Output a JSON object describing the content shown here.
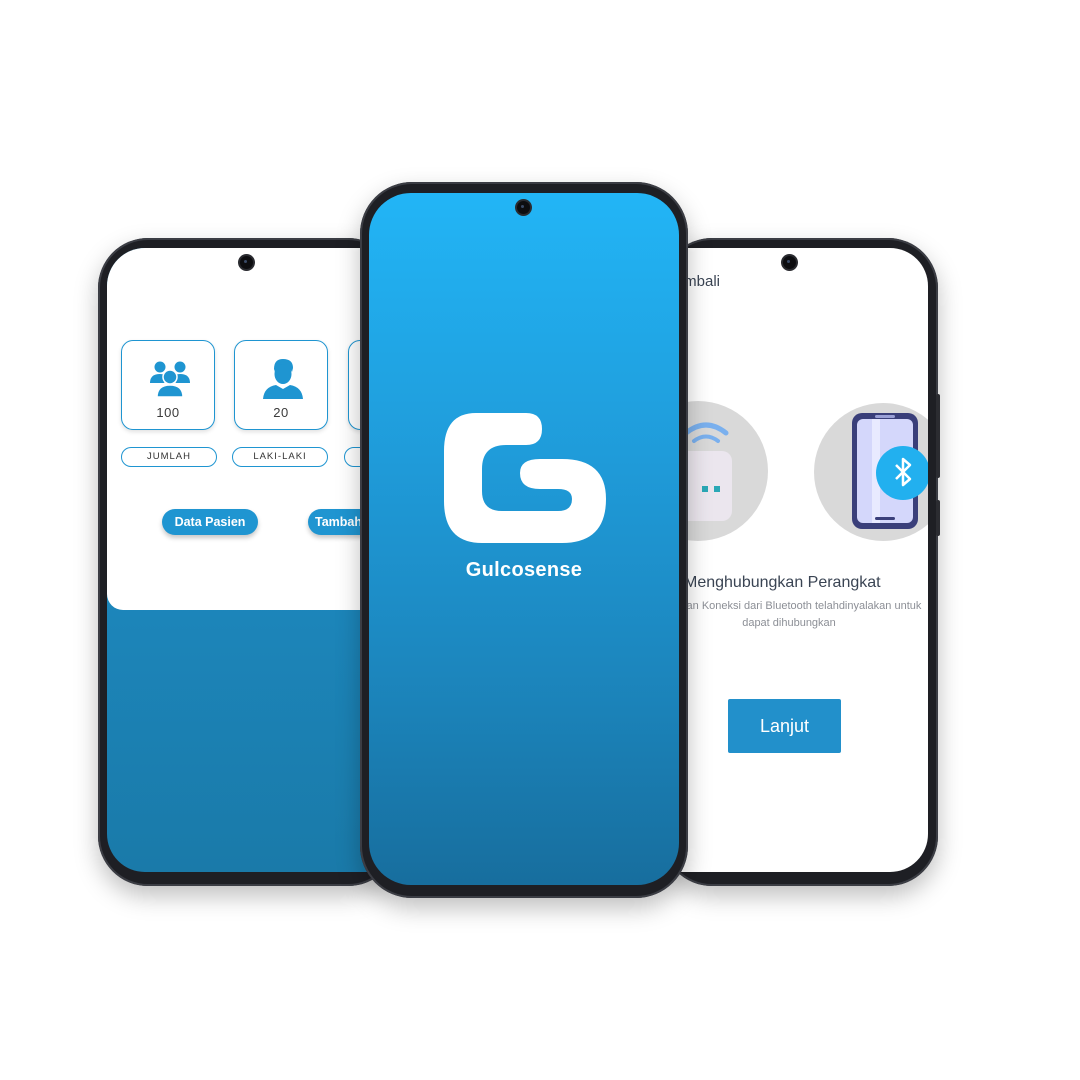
{
  "left_screen": {
    "stats": [
      {
        "icon": "group-users-icon",
        "value": "100",
        "label": "JUMLAH"
      },
      {
        "icon": "male-user-icon",
        "value": "20",
        "label": "LAKI-LAKI"
      }
    ],
    "buttons": {
      "data_pasien": "Data Pasien",
      "tambah": "Tambah"
    }
  },
  "center_screen": {
    "brand_name": "Gulcosense",
    "logo_icon": "gulcosense-g-logo"
  },
  "right_screen": {
    "back_label": "Kembali",
    "title": "Menghubungkan Perangkat",
    "description": "Pastikan Koneksi dari Bluetooth telahdinyalakan untuk dapat dihubungkan",
    "next_button": "Lanjut",
    "illustrations": [
      "glucose-device-icon",
      "phone-bluetooth-icon"
    ]
  },
  "colors": {
    "primary": "#1f95d1",
    "gradient_top": "#22b5f6",
    "gradient_bottom": "#176e9e",
    "button": "#2290cb"
  }
}
